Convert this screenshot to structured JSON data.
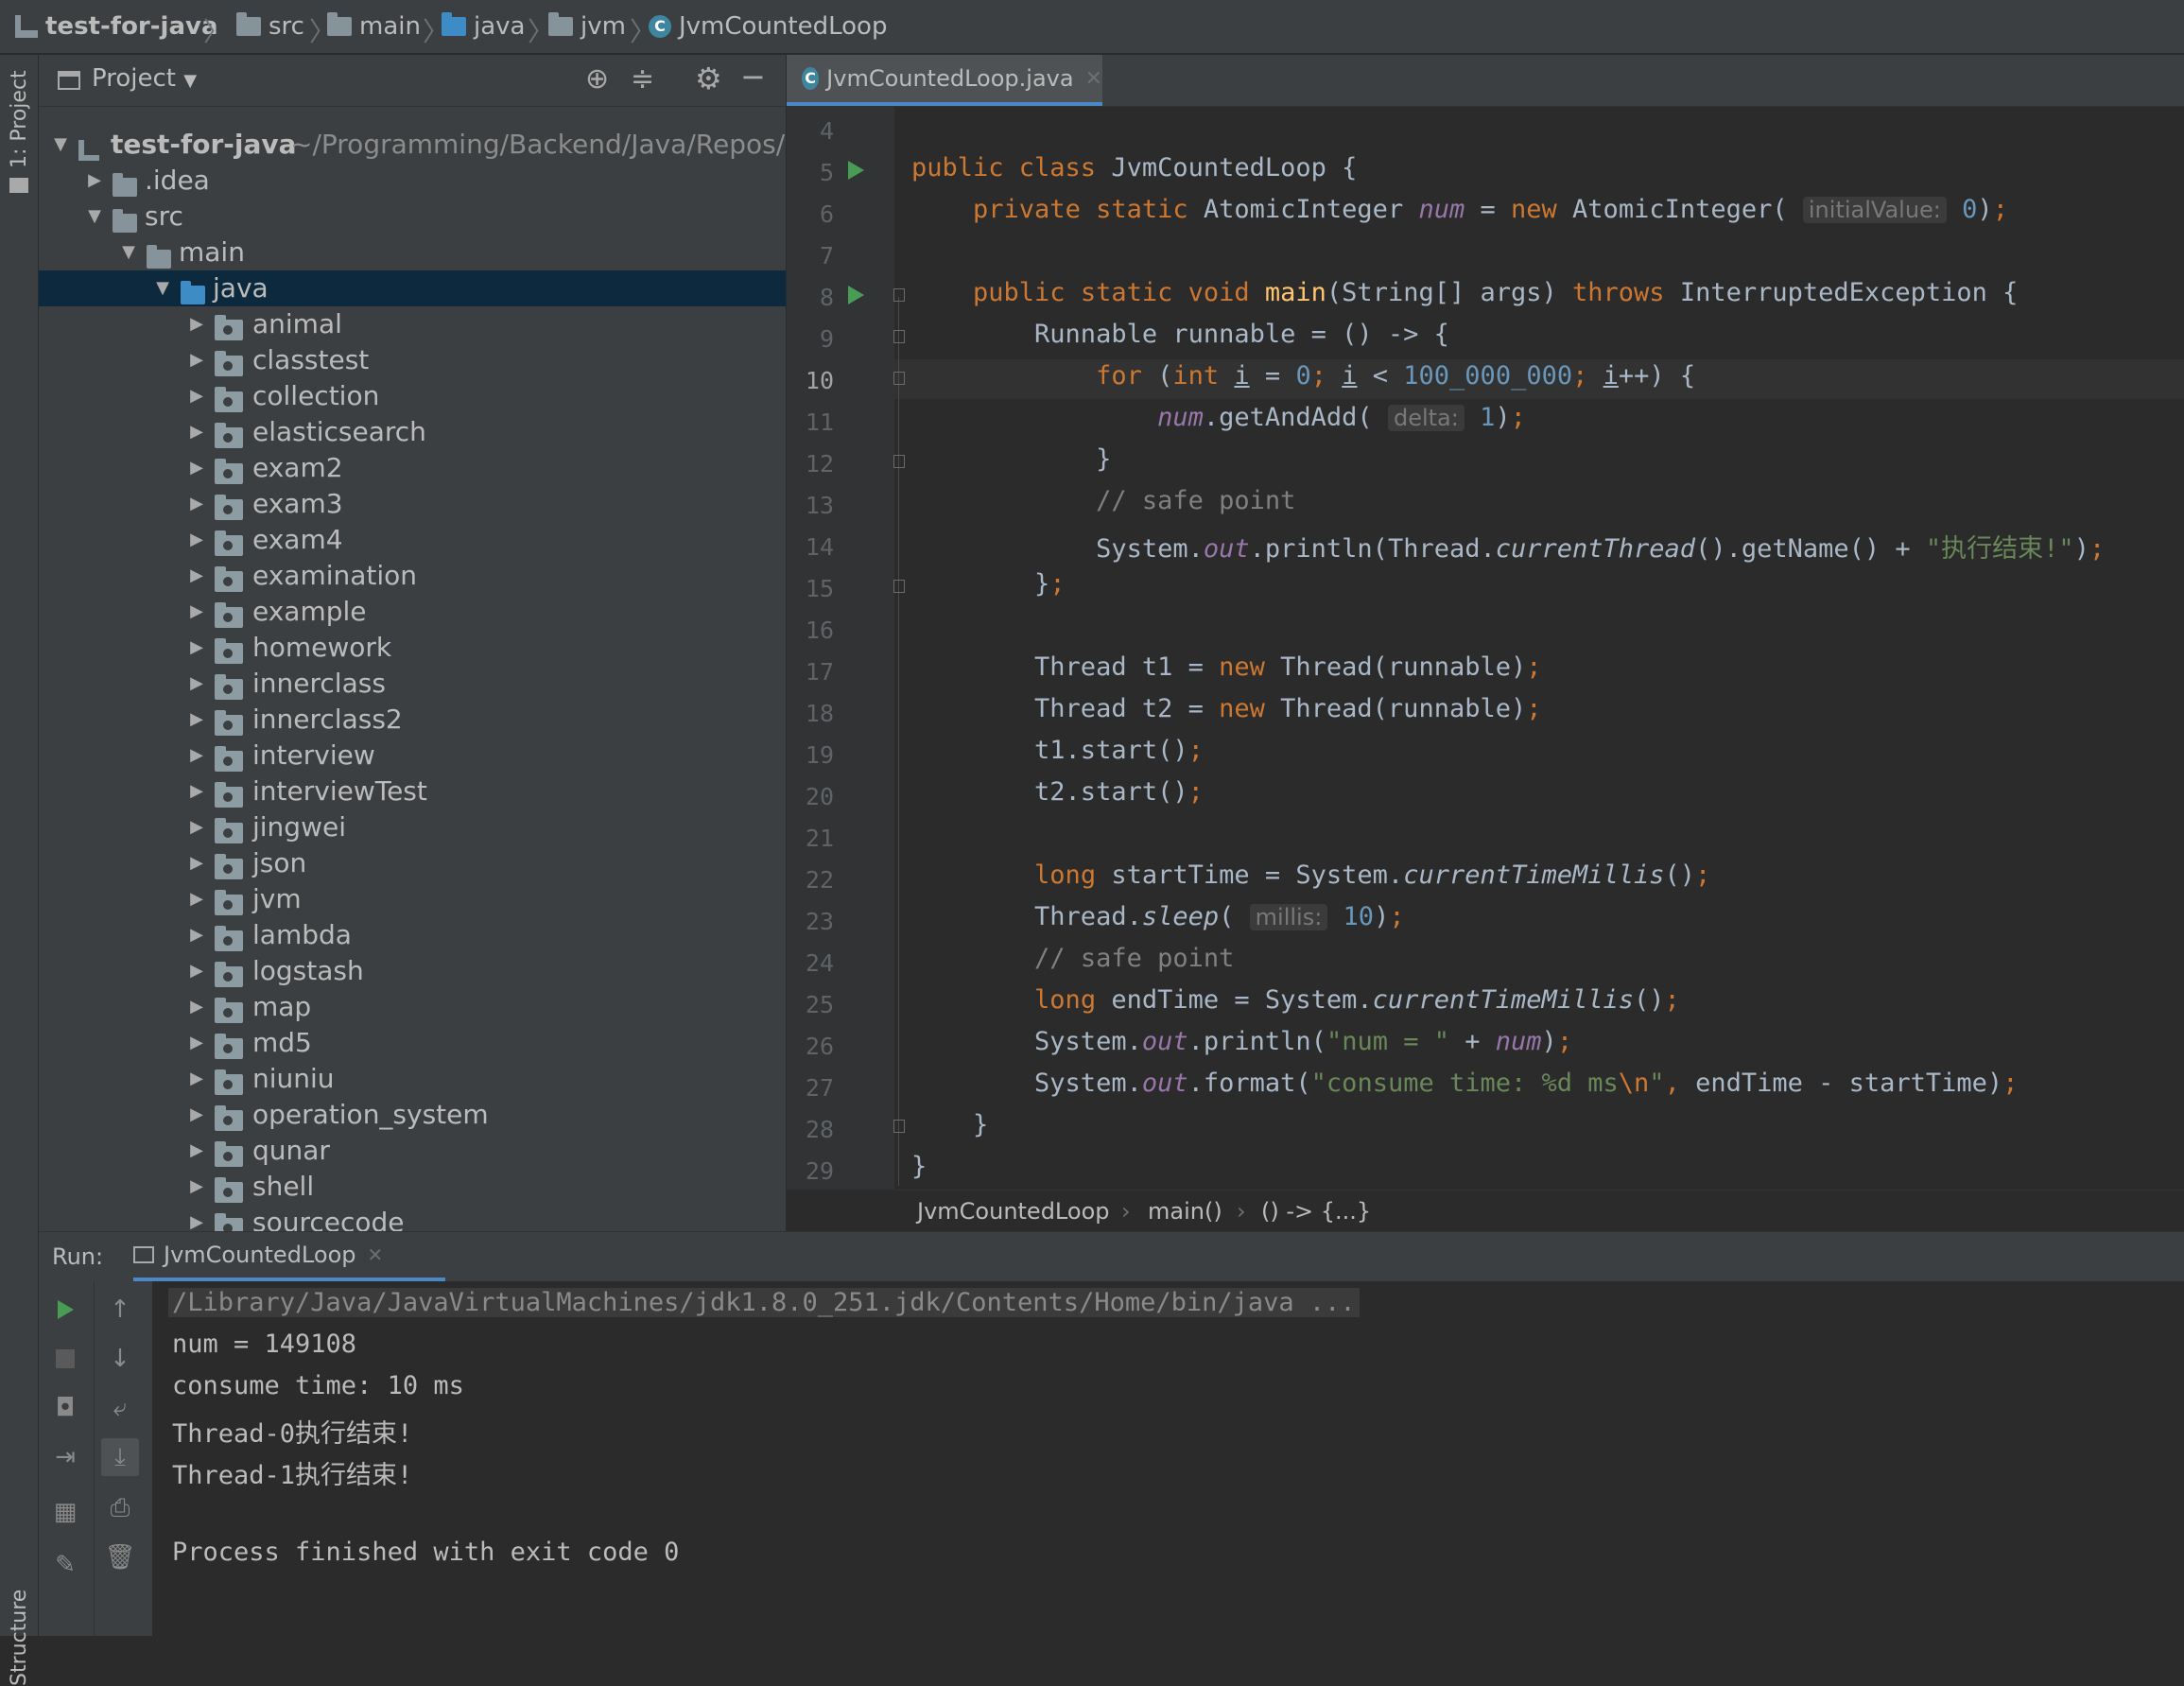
{
  "breadcrumbs": [
    "test-for-java",
    "src",
    "main",
    "java",
    "jvm",
    "JvmCountedLoop"
  ],
  "left_strip": {
    "project_label": "1: Project",
    "structure_label": "Structure"
  },
  "project_panel": {
    "title": "Project",
    "root": {
      "name": "test-for-java",
      "path": "~/Programming/Backend/Java/Repos/tes"
    },
    "rows": [
      {
        "label": "test-for-java",
        "depth": 0,
        "expanded": true,
        "type": "project"
      },
      {
        "label": ".idea",
        "depth": 1,
        "expanded": false,
        "type": "folder"
      },
      {
        "label": "src",
        "depth": 1,
        "expanded": true,
        "type": "folder"
      },
      {
        "label": "main",
        "depth": 2,
        "expanded": true,
        "type": "folder"
      },
      {
        "label": "java",
        "depth": 3,
        "expanded": true,
        "type": "source",
        "selected": true
      },
      {
        "label": "animal",
        "depth": 4,
        "type": "package"
      },
      {
        "label": "classtest",
        "depth": 4,
        "type": "package"
      },
      {
        "label": "collection",
        "depth": 4,
        "type": "package"
      },
      {
        "label": "elasticsearch",
        "depth": 4,
        "type": "package"
      },
      {
        "label": "exam2",
        "depth": 4,
        "type": "package"
      },
      {
        "label": "exam3",
        "depth": 4,
        "type": "package"
      },
      {
        "label": "exam4",
        "depth": 4,
        "type": "package"
      },
      {
        "label": "examination",
        "depth": 4,
        "type": "package"
      },
      {
        "label": "example",
        "depth": 4,
        "type": "package"
      },
      {
        "label": "homework",
        "depth": 4,
        "type": "package"
      },
      {
        "label": "innerclass",
        "depth": 4,
        "type": "package"
      },
      {
        "label": "innerclass2",
        "depth": 4,
        "type": "package"
      },
      {
        "label": "interview",
        "depth": 4,
        "type": "package"
      },
      {
        "label": "interviewTest",
        "depth": 4,
        "type": "package"
      },
      {
        "label": "jingwei",
        "depth": 4,
        "type": "package"
      },
      {
        "label": "json",
        "depth": 4,
        "type": "package"
      },
      {
        "label": "jvm",
        "depth": 4,
        "type": "package"
      },
      {
        "label": "lambda",
        "depth": 4,
        "type": "package"
      },
      {
        "label": "logstash",
        "depth": 4,
        "type": "package"
      },
      {
        "label": "map",
        "depth": 4,
        "type": "package"
      },
      {
        "label": "md5",
        "depth": 4,
        "type": "package"
      },
      {
        "label": "niuniu",
        "depth": 4,
        "type": "package"
      },
      {
        "label": "operation_system",
        "depth": 4,
        "type": "package"
      },
      {
        "label": "qunar",
        "depth": 4,
        "type": "package"
      },
      {
        "label": "shell",
        "depth": 4,
        "type": "package"
      },
      {
        "label": "sourcecode",
        "depth": 4,
        "type": "package"
      }
    ]
  },
  "editor": {
    "tab_label": "JvmCountedLoop.java",
    "current_line": 10,
    "line_numbers": [
      "4",
      "5",
      "6",
      "7",
      "8",
      "9",
      "10",
      "11",
      "12",
      "13",
      "14",
      "15",
      "16",
      "17",
      "18",
      "19",
      "20",
      "21",
      "22",
      "23",
      "24",
      "25",
      "26",
      "27",
      "28",
      "29"
    ],
    "breadcrumb": [
      "JvmCountedLoop",
      "main()",
      "() -> {...}"
    ]
  },
  "run_panel": {
    "label": "Run:",
    "tab_label": "JvmCountedLoop",
    "output": [
      "/Library/Java/JavaVirtualMachines/jdk1.8.0_251.jdk/Contents/Home/bin/java ...",
      "num = 149108",
      "consume time: 10 ms",
      "Thread-0执行结束!",
      "Thread-1执行结束!",
      "",
      "Process finished with exit code 0"
    ]
  },
  "colors": {
    "accent": "#4a88c7",
    "keyword": "#cc7832",
    "field": "#9876aa",
    "number": "#6897bb",
    "string": "#6a8759",
    "method_decl": "#ffc66d",
    "run_green": "#499c54"
  }
}
